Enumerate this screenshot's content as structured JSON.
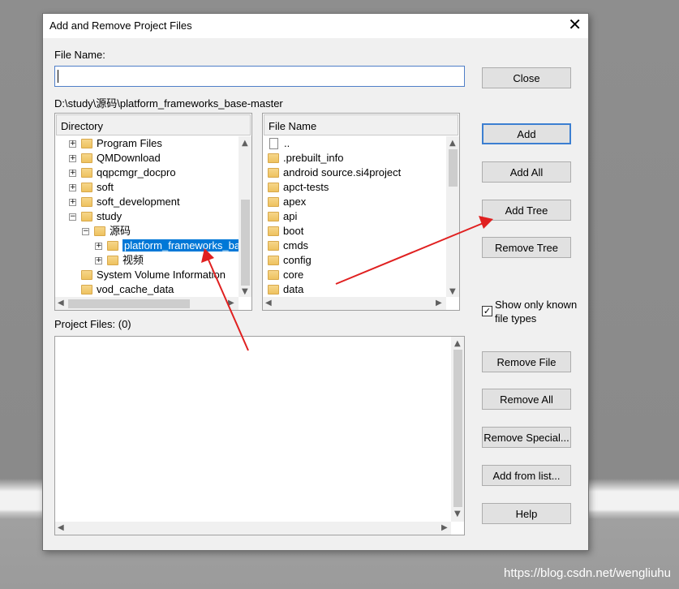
{
  "dialog": {
    "title": "Add and Remove Project Files",
    "file_name_label": "File Name:",
    "file_name_value": "",
    "current_path": "D:\\study\\源码\\platform_frameworks_base-master",
    "project_files_label": "Project Files: (0)",
    "show_known_label_1": "Show only known",
    "show_known_label_2": "file types",
    "show_known_checked": true
  },
  "directory": {
    "header": "Directory",
    "items": [
      {
        "label": "Program Files",
        "level": 0,
        "expander": "+"
      },
      {
        "label": "QMDownload",
        "level": 0,
        "expander": "+"
      },
      {
        "label": "qqpcmgr_docpro",
        "level": 0,
        "expander": "+"
      },
      {
        "label": "soft",
        "level": 0,
        "expander": "+"
      },
      {
        "label": "soft_development",
        "level": 0,
        "expander": "+"
      },
      {
        "label": "study",
        "level": 0,
        "expander": "-"
      },
      {
        "label": "源码",
        "level": 1,
        "expander": "-"
      },
      {
        "label": "platform_frameworks_ba",
        "level": 2,
        "expander": "+",
        "selected": true
      },
      {
        "label": "视频",
        "level": 2,
        "expander": "+"
      },
      {
        "label": "System Volume Information",
        "level": 0,
        "expander": ""
      },
      {
        "label": "vod_cache_data",
        "level": 0,
        "expander": ""
      }
    ]
  },
  "files": {
    "header": "File Name",
    "items": [
      {
        "label": "..",
        "kind": "doc"
      },
      {
        "label": ".prebuilt_info",
        "kind": "folder"
      },
      {
        "label": "android source.si4project",
        "kind": "folder"
      },
      {
        "label": "apct-tests",
        "kind": "folder"
      },
      {
        "label": "apex",
        "kind": "folder"
      },
      {
        "label": "api",
        "kind": "folder"
      },
      {
        "label": "boot",
        "kind": "folder"
      },
      {
        "label": "cmds",
        "kind": "folder"
      },
      {
        "label": "config",
        "kind": "folder"
      },
      {
        "label": "core",
        "kind": "folder"
      },
      {
        "label": "data",
        "kind": "folder"
      }
    ]
  },
  "buttons": {
    "close": "Close",
    "add": "Add",
    "add_all": "Add All",
    "add_tree": "Add Tree",
    "remove_tree": "Remove Tree",
    "remove_file": "Remove File",
    "remove_all": "Remove All",
    "remove_special": "Remove Special...",
    "add_from_list": "Add from list...",
    "help": "Help"
  },
  "watermark": "https://blog.csdn.net/wengliuhu",
  "colors": {
    "annotation_arrow": "#e02020",
    "selection": "#0078d7",
    "folder": "#eec25f",
    "default_button_border": "#3c7fd1"
  }
}
